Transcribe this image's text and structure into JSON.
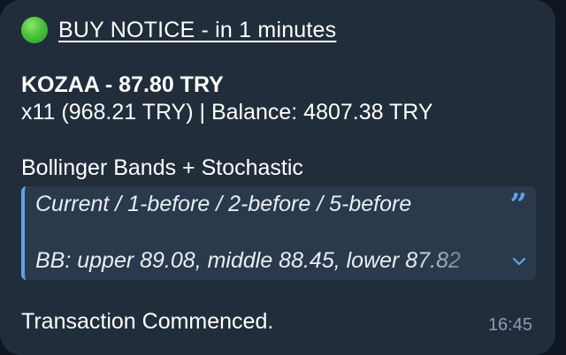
{
  "message": {
    "title": "BUY NOTICE - in 1 minutes",
    "status_icon": "green-circle-icon",
    "ticker_line": "KOZAA - 87.80 TRY",
    "position_line": "x11 (968.21 TRY) | Balance: 4807.38 TRY",
    "strategy": "Bollinger Bands + Stochastic",
    "quote": {
      "line1": "Current / 1-before / 2-before / 5-before",
      "line2": "BB:  upper 89.08, middle 88.45, lower 87.82",
      "accent_color": "#5fa3e8"
    },
    "footer": "Transaction Commenced.",
    "time": "16:45"
  }
}
